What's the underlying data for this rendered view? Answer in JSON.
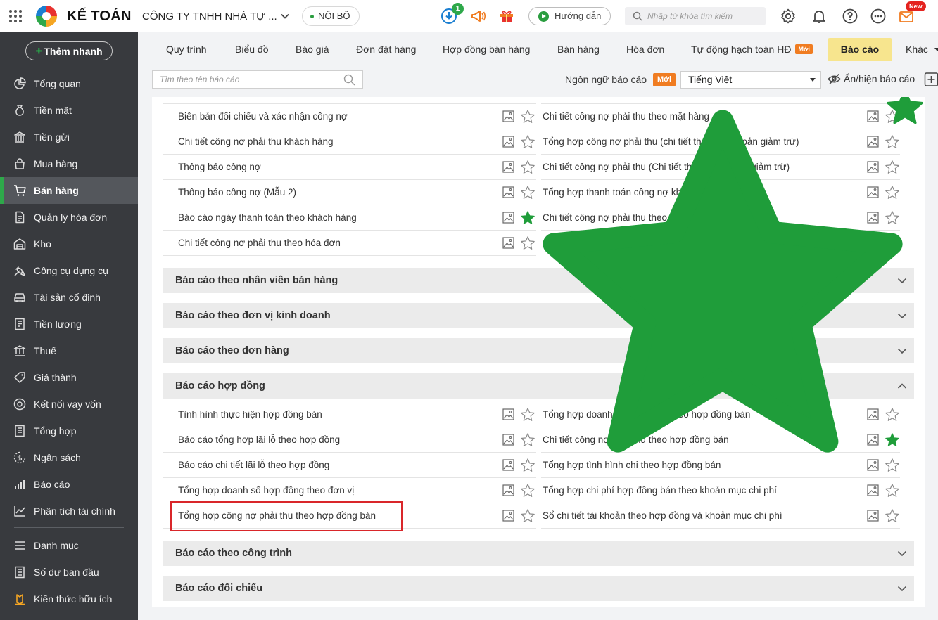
{
  "header": {
    "brand": "KẾ TOÁN",
    "company": "CÔNG TY TNHH NHÀ TỰ ...",
    "scope": "NỘI BỘ",
    "download_badge": "1",
    "guide_label": "Hướng dẫn",
    "search_placeholder": "Nhập từ khóa tìm kiếm",
    "new_badge": "New"
  },
  "sidebar": {
    "quick_add": "Thêm nhanh",
    "items": [
      {
        "label": "Tổng quan",
        "icon": "pie-chart-icon"
      },
      {
        "label": "Tiền mặt",
        "icon": "money-bag-icon"
      },
      {
        "label": "Tiền gửi",
        "icon": "bank-icon"
      },
      {
        "label": "Mua hàng",
        "icon": "shopping-bag-icon"
      },
      {
        "label": "Bán hàng",
        "icon": "cart-icon"
      },
      {
        "label": "Quản lý hóa đơn",
        "icon": "invoice-icon"
      },
      {
        "label": "Kho",
        "icon": "warehouse-icon"
      },
      {
        "label": "Công cụ dụng cụ",
        "icon": "tools-icon"
      },
      {
        "label": "Tài sản cố định",
        "icon": "car-icon"
      },
      {
        "label": "Tiền lương",
        "icon": "payroll-icon"
      },
      {
        "label": "Thuế",
        "icon": "tax-icon"
      },
      {
        "label": "Giá thành",
        "icon": "price-tag-icon"
      },
      {
        "label": "Kết nối vay vốn",
        "icon": "loan-icon"
      },
      {
        "label": "Tổng hợp",
        "icon": "summary-icon"
      },
      {
        "label": "Ngân sách",
        "icon": "budget-icon"
      },
      {
        "label": "Báo cáo",
        "icon": "bar-chart-icon"
      },
      {
        "label": "Phân tích tài chính",
        "icon": "line-chart-icon"
      },
      {
        "label": "Danh mục",
        "icon": "list-icon"
      },
      {
        "label": "Số dư ban đầu",
        "icon": "opening-balance-icon"
      },
      {
        "label": "Kiến thức hữu ích",
        "icon": "knowledge-icon"
      }
    ],
    "active": "Bán hàng"
  },
  "tabs": [
    {
      "label": "Quy trình"
    },
    {
      "label": "Biểu đồ"
    },
    {
      "label": "Báo giá"
    },
    {
      "label": "Đơn đặt hàng"
    },
    {
      "label": "Hợp đồng bán hàng"
    },
    {
      "label": "Bán hàng"
    },
    {
      "label": "Hóa đơn"
    },
    {
      "label": "Tự động hạch toán HĐ",
      "badge": "Mới"
    },
    {
      "label": "Báo cáo"
    },
    {
      "label": "Khác"
    }
  ],
  "active_tab": "Báo cáo",
  "toolbar": {
    "search_placeholder": "Tìm theo tên báo cáo",
    "language_label": "Ngôn ngữ báo cáo",
    "language_badge": "Mới",
    "language_value": "Tiếng Việt",
    "show_hide_label": "Ẩn/hiện báo cáo"
  },
  "debt_reports": {
    "left": [
      {
        "name": "Biên bản đối chiếu và xác nhận công nợ",
        "favorite": false
      },
      {
        "name": "Chi tiết công nợ phải thu khách hàng",
        "favorite": false
      },
      {
        "name": "Thông báo công nợ",
        "favorite": false
      },
      {
        "name": "Thông báo công nợ (Mẫu 2)",
        "favorite": false
      },
      {
        "name": "Báo cáo ngày thanh toán theo khách hàng",
        "favorite": true
      },
      {
        "name": "Chi tiết công nợ phải thu theo hóa đơn",
        "favorite": false
      }
    ],
    "right": [
      {
        "name": "Chi tiết công nợ phải thu theo mặt hàng",
        "favorite": false
      },
      {
        "name": "Tổng hợp công nợ phải thu (chi tiết theo các khoản giảm trừ)",
        "favorite": false
      },
      {
        "name": "Chi tiết công nợ phải thu (Chi tiết theo các khoản giảm trừ)",
        "favorite": false
      },
      {
        "name": "Tổng hợp thanh toán công nợ khách hàng",
        "favorite": false
      },
      {
        "name": "Chi tiết công nợ phải thu theo tuổi nợ",
        "favorite": false
      }
    ]
  },
  "sections": [
    {
      "title": "Báo cáo theo nhân viên bán hàng",
      "expanded": false
    },
    {
      "title": "Báo cáo theo đơn vị kinh doanh",
      "expanded": false
    },
    {
      "title": "Báo cáo theo đơn hàng",
      "expanded": false
    },
    {
      "title": "Báo cáo hợp đồng",
      "expanded": true
    },
    {
      "title": "Báo cáo theo công trình",
      "expanded": false
    },
    {
      "title": "Báo cáo đối chiếu",
      "expanded": false
    }
  ],
  "contract_reports": {
    "left": [
      {
        "name": "Tình hình thực hiện hợp đồng bán",
        "favorite": false
      },
      {
        "name": "Báo cáo tổng hợp lãi lỗ theo hợp đồng",
        "favorite": false
      },
      {
        "name": "Báo cáo chi tiết lãi lỗ theo hợp đồng",
        "favorite": false
      },
      {
        "name": "Tổng hợp doanh số hợp đồng theo đơn vị",
        "favorite": false
      },
      {
        "name": "Tổng hợp công nợ phải thu theo hợp đồng bán",
        "favorite": false
      }
    ],
    "right": [
      {
        "name": "Tổng hợp doanh số mặt hàng theo hợp đồng bán",
        "favorite": false
      },
      {
        "name": "Chi tiết công nợ phải thu theo hợp đồng bán",
        "favorite": true
      },
      {
        "name": "Tổng hợp tình hình chi theo hợp đồng bán",
        "favorite": false
      },
      {
        "name": "Tổng hợp chi phí hợp đồng bán theo khoản mục chi phí",
        "favorite": false
      },
      {
        "name": "Sổ chi tiết tài khoản theo hợp đồng và khoản mục chi phí",
        "favorite": false
      }
    ]
  },
  "colors": {
    "sidebar_bg": "#383a3e",
    "active_accent": "#2ea84a",
    "active_tab_bg": "#f7e58e",
    "badge_orange": "#f07c21",
    "favorite_star": "#1f9d3a",
    "highlight": "#d9262a"
  }
}
